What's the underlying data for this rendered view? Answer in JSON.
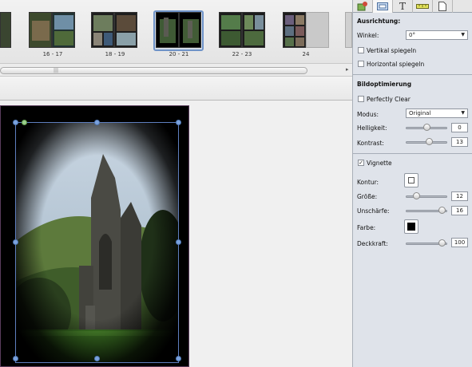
{
  "filmstrip": {
    "spreads": [
      {
        "label": "",
        "partial": true
      },
      {
        "label": "16 - 17"
      },
      {
        "label": "18 - 19"
      },
      {
        "label": "20 - 21",
        "selected": true
      },
      {
        "label": "22 - 23"
      },
      {
        "label": "24"
      }
    ]
  },
  "panel": {
    "tabs": [
      "layout-icon",
      "frame-icon",
      "T",
      "ruler-icon",
      "page-icon"
    ],
    "orientation": {
      "title": "Ausrichtung:",
      "angle_label": "Winkel:",
      "angle_value": "0°",
      "flip_vertical": "Vertikal spiegeln",
      "flip_horizontal": "Horizontal spiegeln"
    },
    "optimize": {
      "title": "Bildoptimierung",
      "perfectly_clear": "Perfectly Clear",
      "mode_label": "Modus:",
      "mode_value": "Original",
      "brightness_label": "Helligkeit:",
      "brightness_value": "0",
      "brightness_level": 0.5,
      "contrast_label": "Kontrast:",
      "contrast_value": "13",
      "contrast_level": 0.56
    },
    "vignette": {
      "label": "Vignette",
      "checked": true,
      "outline_label": "Kontur:",
      "size_label": "Größe:",
      "size_value": "12",
      "size_level": 0.25,
      "blur_label": "Unschärfe:",
      "blur_value": "16",
      "blur_level": 0.88,
      "color_label": "Farbe:",
      "color_value": "#000000",
      "opacity_label": "Deckkraft:",
      "opacity_value": "100",
      "opacity_level": 0.88
    }
  },
  "colors": {
    "selection": "#6f93c8",
    "panel_bg": "#dfe3ea"
  }
}
